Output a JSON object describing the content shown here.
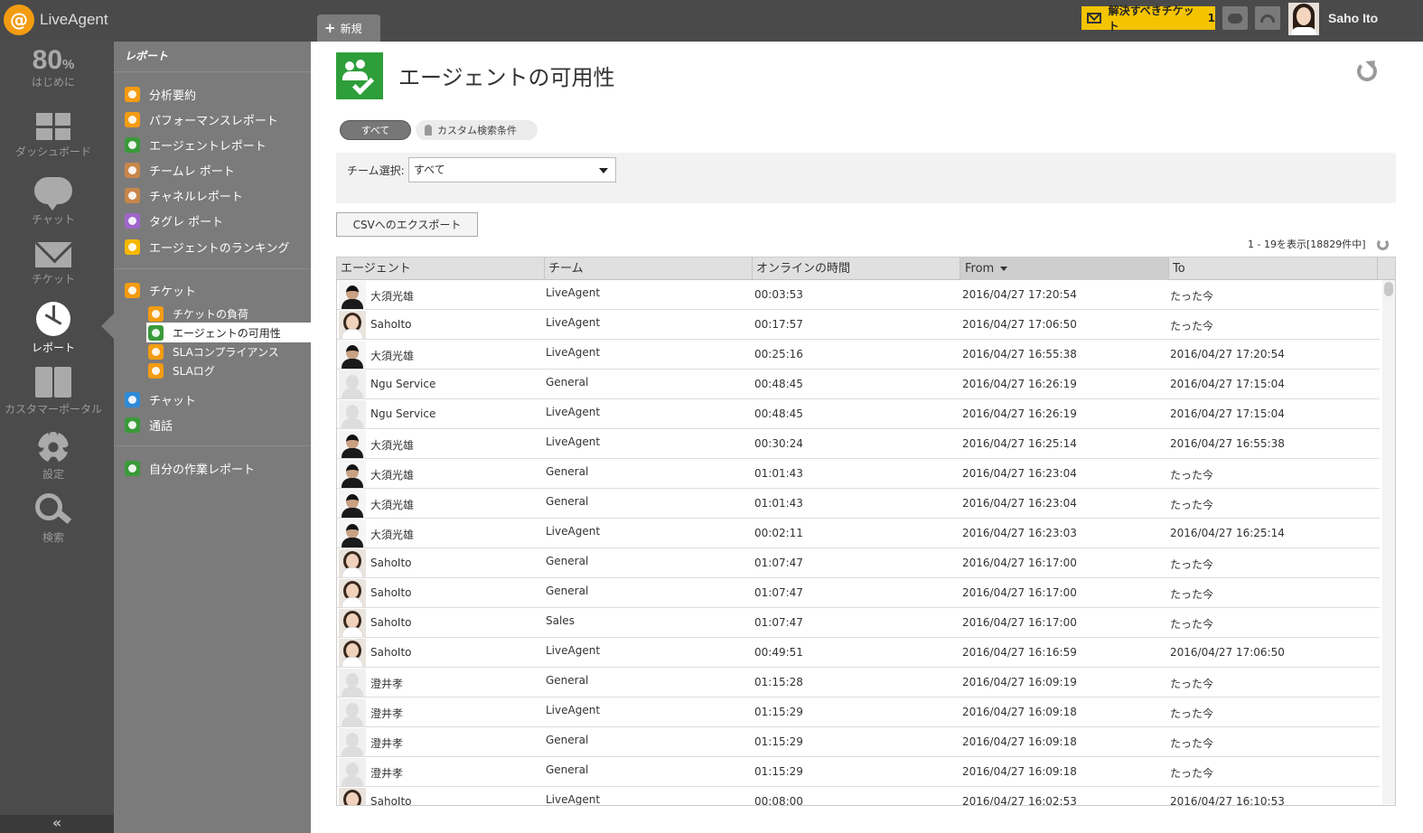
{
  "app": {
    "logo_symbol": "@",
    "name": "LiveAgent",
    "new_tab_label": "新規"
  },
  "header": {
    "ticket_alert": "解決すべきチケット",
    "ticket_count": "1",
    "user_name": "Saho Ito",
    "alert_color": "#f5c400"
  },
  "leftnav": {
    "percent": "80",
    "percent_unit": "%",
    "items": [
      {
        "label": "はじめに",
        "icon": "progress-percent"
      },
      {
        "label": "ダッシュボード",
        "icon": "dashboard-icon"
      },
      {
        "label": "チャット",
        "icon": "chat-icon"
      },
      {
        "label": "チケット",
        "icon": "mail-icon"
      },
      {
        "label": "レポート",
        "icon": "report-icon",
        "active": true
      },
      {
        "label": "カスタマーポータル",
        "icon": "book-icon"
      },
      {
        "label": "設定",
        "icon": "gear-icon"
      },
      {
        "label": "検索",
        "icon": "search-icon"
      }
    ],
    "collapse_label": "«"
  },
  "subnav": {
    "title": "レポート",
    "items": [
      {
        "label": "分析要約",
        "icon": "summary-icon"
      },
      {
        "label": "パフォーマンスレポート",
        "icon": "performance-icon"
      },
      {
        "label": "エージェントレポート",
        "icon": "agent-report-icon"
      },
      {
        "label": "チームレ ポート",
        "icon": "team-report-icon"
      },
      {
        "label": "チャネルレポート",
        "icon": "channel-report-icon"
      },
      {
        "label": "タグレ ポート",
        "icon": "tag-report-icon"
      },
      {
        "label": "エージェントのランキング",
        "icon": "ranking-icon"
      },
      {
        "label": "チケット",
        "icon": "ticket-icon"
      },
      {
        "label": "チケットの負荷",
        "icon": "ticket-load-icon"
      },
      {
        "label": "エージェントの可用性",
        "icon": "availability-icon",
        "selected": true
      },
      {
        "label": "SLAコンプライアンス",
        "icon": "sla-compliance-icon"
      },
      {
        "label": "SLAログ",
        "icon": "sla-log-icon"
      },
      {
        "label": "チャット",
        "icon": "chat-report-icon"
      },
      {
        "label": "通話",
        "icon": "call-icon"
      },
      {
        "label": "自分の作業レポート",
        "icon": "my-work-icon"
      }
    ]
  },
  "main": {
    "title": "エージェントの可用性",
    "filters": {
      "all": "すべて",
      "custom": "カスタム検索条件"
    },
    "team_select_label": "チーム選択:",
    "team_select_value": "すべて",
    "export_button": "CSVへのエクスポート",
    "paging": "1 - 19を表示[18829件中]"
  },
  "table": {
    "columns": [
      "エージェント",
      "チーム",
      "オンラインの時間",
      "From",
      "To"
    ],
    "sorted_column": "From",
    "rows": [
      {
        "avatar": "male",
        "agent": "大須光雄",
        "team": "LiveAgent",
        "online": "00:03:53",
        "from": "2016/04/27 17:20:54",
        "to": "たった今"
      },
      {
        "avatar": "female",
        "agent": "SahoIto",
        "team": "LiveAgent",
        "online": "00:17:57",
        "from": "2016/04/27 17:06:50",
        "to": "たった今"
      },
      {
        "avatar": "male",
        "agent": "大須光雄",
        "team": "LiveAgent",
        "online": "00:25:16",
        "from": "2016/04/27 16:55:38",
        "to": "2016/04/27 17:20:54"
      },
      {
        "avatar": "none",
        "agent": "Ngu Service",
        "team": "General",
        "online": "00:48:45",
        "from": "2016/04/27 16:26:19",
        "to": "2016/04/27 17:15:04"
      },
      {
        "avatar": "none",
        "agent": "Ngu Service",
        "team": "LiveAgent",
        "online": "00:48:45",
        "from": "2016/04/27 16:26:19",
        "to": "2016/04/27 17:15:04"
      },
      {
        "avatar": "male",
        "agent": "大須光雄",
        "team": "LiveAgent",
        "online": "00:30:24",
        "from": "2016/04/27 16:25:14",
        "to": "2016/04/27 16:55:38"
      },
      {
        "avatar": "male",
        "agent": "大須光雄",
        "team": "General",
        "online": "01:01:43",
        "from": "2016/04/27 16:23:04",
        "to": "たった今"
      },
      {
        "avatar": "male",
        "agent": "大須光雄",
        "team": "General",
        "online": "01:01:43",
        "from": "2016/04/27 16:23:04",
        "to": "たった今"
      },
      {
        "avatar": "male",
        "agent": "大須光雄",
        "team": "LiveAgent",
        "online": "00:02:11",
        "from": "2016/04/27 16:23:03",
        "to": "2016/04/27 16:25:14"
      },
      {
        "avatar": "female",
        "agent": "SahoIto",
        "team": "General",
        "online": "01:07:47",
        "from": "2016/04/27 16:17:00",
        "to": "たった今"
      },
      {
        "avatar": "female",
        "agent": "SahoIto",
        "team": "General",
        "online": "01:07:47",
        "from": "2016/04/27 16:17:00",
        "to": "たった今"
      },
      {
        "avatar": "female",
        "agent": "SahoIto",
        "team": "Sales",
        "online": "01:07:47",
        "from": "2016/04/27 16:17:00",
        "to": "たった今"
      },
      {
        "avatar": "female",
        "agent": "SahoIto",
        "team": "LiveAgent",
        "online": "00:49:51",
        "from": "2016/04/27 16:16:59",
        "to": "2016/04/27 17:06:50"
      },
      {
        "avatar": "none",
        "agent": "澄井孝",
        "team": "General",
        "online": "01:15:28",
        "from": "2016/04/27 16:09:19",
        "to": "たった今"
      },
      {
        "avatar": "none",
        "agent": "澄井孝",
        "team": "LiveAgent",
        "online": "01:15:29",
        "from": "2016/04/27 16:09:18",
        "to": "たった今"
      },
      {
        "avatar": "none",
        "agent": "澄井孝",
        "team": "General",
        "online": "01:15:29",
        "from": "2016/04/27 16:09:18",
        "to": "たった今"
      },
      {
        "avatar": "none",
        "agent": "澄井孝",
        "team": "General",
        "online": "01:15:29",
        "from": "2016/04/27 16:09:18",
        "to": "たった今"
      },
      {
        "avatar": "female",
        "agent": "SahoIto",
        "team": "LiveAgent",
        "online": "00:08:00",
        "from": "2016/04/27 16:02:53",
        "to": "2016/04/27 16:10:53"
      }
    ]
  }
}
